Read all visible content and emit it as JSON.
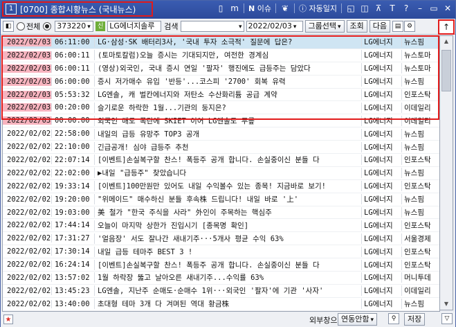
{
  "window": {
    "number": "1",
    "title": "[0700] 종합시황뉴스 (국내뉴스)",
    "menu_icon": "m",
    "issue_label": "이슈",
    "journal_label": "자동일지",
    "help_label": "?",
    "text_label": "T"
  },
  "toolbar": {
    "radio_all": "전체",
    "stock_code": "373220",
    "stock_name": "LG에너지솔루",
    "search_label": "검색",
    "search_value": "",
    "date": "2022/02/03",
    "group_select": "그룹선택",
    "query_button": "조회",
    "next_button": "다음",
    "up_button": "↑"
  },
  "rows": [
    {
      "date": "2022/02/03",
      "time": "06:11:00",
      "title": "LG·삼성·SK 배터리3사, '국내 투자 소극적' 질문에 답은?",
      "code": "LG에너지",
      "src": "뉴스핌",
      "hl": true,
      "sel": true
    },
    {
      "date": "2022/02/03",
      "time": "06:00:11",
      "title": "(토마토칼럼)오늘 증시는 기대되지만, 여전한 경계심",
      "code": "LG에너지",
      "src": "뉴스토마",
      "hl": true,
      "sel": false
    },
    {
      "date": "2022/02/03",
      "time": "06:00:11",
      "title": "(영상)외국인, 국내 증시 연일 '팔자' 행진에도 급등주는 담았다",
      "code": "LG에너지",
      "src": "뉴스토마",
      "hl": true,
      "sel": false
    },
    {
      "date": "2022/02/03",
      "time": "06:00:00",
      "title": "증시 저가매수 유입 '반등'...코스피 '2700' 회복 유력",
      "code": "LG에너지",
      "src": "뉴스핌",
      "hl": true,
      "sel": false
    },
    {
      "date": "2022/02/03",
      "time": "05:53:32",
      "title": "LG엔솔, 캐 벌칸에너지와 저탄소 수산화리튬 공급 계약",
      "code": "LG에너지",
      "src": "인포스탁",
      "hl": true,
      "sel": false
    },
    {
      "date": "2022/02/03",
      "time": "00:20:00",
      "title": "슬기로운 하락한 1월...기관의 둥지은?",
      "code": "LG에너지",
      "src": "이데일리",
      "hl": true,
      "sel": false
    },
    {
      "date": "2022/02/03",
      "time": "00:00:00",
      "title": "외국인 매도 폭탄에 SKIET 이어 LG엔솔도 무릎",
      "code": "LG에너지",
      "src": "이데일리",
      "hl": true,
      "sel": false
    },
    {
      "date": "2022/02/02",
      "time": "22:58:00",
      "title": "내일의 급등 유망주 TOP3 공개",
      "code": "LG에너지",
      "src": "뉴스핌",
      "hl": false,
      "sel": false
    },
    {
      "date": "2022/02/02",
      "time": "22:10:00",
      "title": "긴급공개! 심야 급등주 추천",
      "code": "LG에너지",
      "src": "뉴스핌",
      "hl": false,
      "sel": false
    },
    {
      "date": "2022/02/02",
      "time": "22:07:14",
      "title": "[이벤트]손실복구할 찬스! 폭등주 공개 합니다. 손실중이신 분들 다",
      "code": "LG에너지",
      "src": "인포스탁",
      "hl": false,
      "sel": false
    },
    {
      "date": "2022/02/02",
      "time": "22:02:00",
      "title": "▶내일 \"급등주\" 찾았습니다",
      "code": "LG에너지",
      "src": "뉴스핌",
      "hl": false,
      "sel": false
    },
    {
      "date": "2022/02/02",
      "time": "19:33:14",
      "title": "[이벤트]100만원만 있어도 내일 수익볼수 있는 종목! 지금바로 보기!",
      "code": "LG에너지",
      "src": "인포스탁",
      "hl": false,
      "sel": false
    },
    {
      "date": "2022/02/02",
      "time": "19:20:00",
      "title": "\"위메이드\" 매수하신 분들 후속株 드립니다! 내일 바로 '上'",
      "code": "LG에너지",
      "src": "뉴스핌",
      "hl": false,
      "sel": false
    },
    {
      "date": "2022/02/02",
      "time": "19:03:00",
      "title": "美 철가 \"한국 주식을 사라\" 外인이 주목하는 핵심주",
      "code": "LG에너지",
      "src": "뉴스핌",
      "hl": false,
      "sel": false
    },
    {
      "date": "2022/02/02",
      "time": "17:44:14",
      "title": "오늘이 마지막 상한가 진입시기 [종목명 확인]",
      "code": "LG에너지",
      "src": "인포스탁",
      "hl": false,
      "sel": false
    },
    {
      "date": "2022/02/02",
      "time": "17:31:27",
      "title": "'얼음장' 서도 잘나간 새내기주···5개사 평균 수익 63%",
      "code": "LG에너지",
      "src": "서울경제",
      "hl": false,
      "sel": false
    },
    {
      "date": "2022/02/02",
      "time": "17:30:14",
      "title": "내일 급등 테마주 BEST 3 !",
      "code": "LG에너지",
      "src": "인포스탁",
      "hl": false,
      "sel": false
    },
    {
      "date": "2022/02/02",
      "time": "16:24:14",
      "title": "[이벤트]손실복구할 찬스! 폭등주 공개 합니다. 손실중이신 분들 다",
      "code": "LG에너지",
      "src": "인포스탁",
      "hl": false,
      "sel": false
    },
    {
      "date": "2022/02/02",
      "time": "13:57:02",
      "title": "1월 하락장 뚫고 날아오른 새내기주...수익률 63%",
      "code": "LG에너지",
      "src": "머니투데",
      "hl": false,
      "sel": false
    },
    {
      "date": "2022/02/02",
      "time": "13:45:23",
      "title": "LG엔솔, 지난주 순매도·순매수 1위···외국인 '팔자'에 기관 '사자'",
      "code": "LG에너지",
      "src": "이데일리",
      "hl": false,
      "sel": false
    },
    {
      "date": "2022/02/02",
      "time": "13:40:00",
      "title": "초대형 테마 3개 다 겨며된 역대 황금株",
      "code": "LG에너지",
      "src": "뉴스핌",
      "hl": false,
      "sel": false
    },
    {
      "date": "2022/02/02",
      "time": "13:23:12",
      "title": "유난히 매섭던 1월 증시, 설 연휴 이후 반등 가능성은?",
      "code": "LG에너지",
      "src": "머니투데",
      "hl": false,
      "sel": false
    },
    {
      "date": "2022/02/02",
      "time": "12:04:44",
      "title": "[현장에서] 알맹이 빠먹는 '물적분할'...\" 소액주주 보호해야\" 정치권",
      "code": "LG에너지",
      "src": "인포스탁",
      "hl": false,
      "sel": false
    }
  ],
  "status": {
    "outer_label": "외부창으로 종목",
    "link_select": "연동안함",
    "save_button": "저장"
  }
}
